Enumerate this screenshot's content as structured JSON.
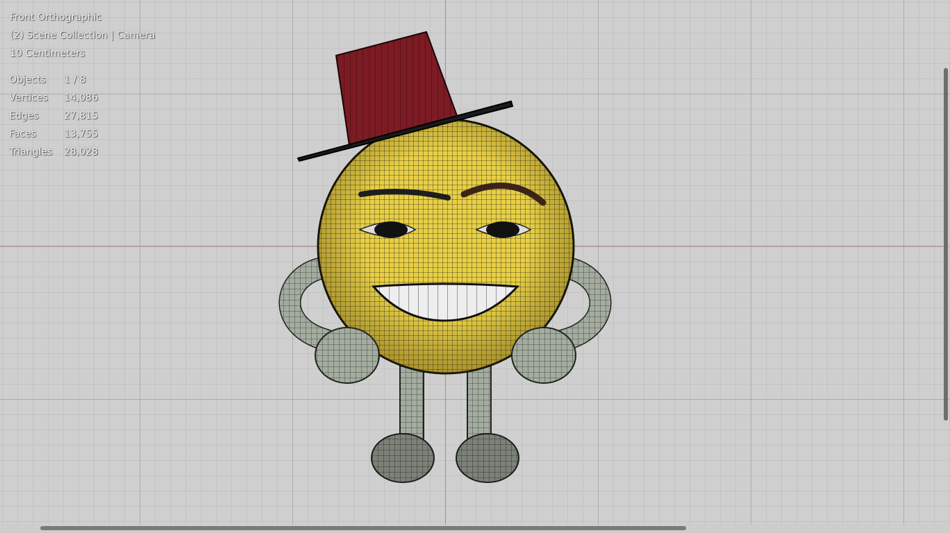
{
  "viewport": {
    "view_name": "Front Orthographic",
    "collection_info": "(2) Scene Collection | Camera",
    "scale_info": "10 Centimeters"
  },
  "stats": {
    "objects": {
      "label": "Objects",
      "value": "1 / 8"
    },
    "vertices": {
      "label": "Vertices",
      "value": "14,086"
    },
    "edges": {
      "label": "Edges",
      "value": "27,815"
    },
    "faces": {
      "label": "Faces",
      "value": "13,755"
    },
    "triangles": {
      "label": "Triangles",
      "value": "28,028"
    }
  },
  "colors": {
    "grid_background": "#cfcfcf",
    "x_axis": "#d98a8a",
    "z_axis": "#7f95c9",
    "head_yellow": "#e8cf45",
    "hat_red": "#8e1f2a",
    "limbs_gray": "#9aa39a"
  }
}
